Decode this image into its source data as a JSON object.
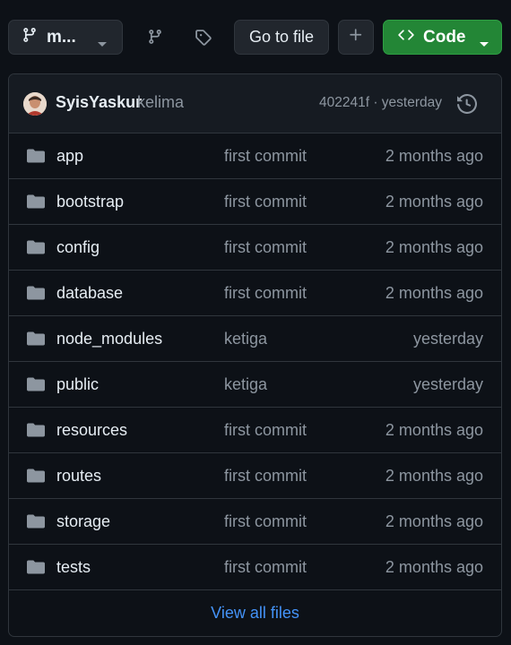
{
  "toolbar": {
    "branch_label": "m...",
    "branch_icon": "git-branch-icon",
    "branches_icon": "git-branch-icon",
    "tags_icon": "tag-icon",
    "goto_label": "Go to file",
    "add_icon": "plus-icon",
    "code_label": "Code",
    "code_icon": "code-icon",
    "accent": "#238636"
  },
  "commit": {
    "user": "SyisYaskur",
    "message": "kelima",
    "meta": "402241f · yesterday",
    "history_icon": "history-icon"
  },
  "files": [
    {
      "name": "app",
      "message": "first commit",
      "date": "2 months ago"
    },
    {
      "name": "bootstrap",
      "message": "first commit",
      "date": "2 months ago"
    },
    {
      "name": "config",
      "message": "first commit",
      "date": "2 months ago"
    },
    {
      "name": "database",
      "message": "first commit",
      "date": "2 months ago"
    },
    {
      "name": "node_modules",
      "message": "ketiga",
      "date": "yesterday"
    },
    {
      "name": "public",
      "message": "ketiga",
      "date": "yesterday"
    },
    {
      "name": "resources",
      "message": "first commit",
      "date": "2 months ago"
    },
    {
      "name": "routes",
      "message": "first commit",
      "date": "2 months ago"
    },
    {
      "name": "storage",
      "message": "first commit",
      "date": "2 months ago"
    },
    {
      "name": "tests",
      "message": "first commit",
      "date": "2 months ago"
    }
  ],
  "footer": {
    "view_all_label": "View all files"
  }
}
